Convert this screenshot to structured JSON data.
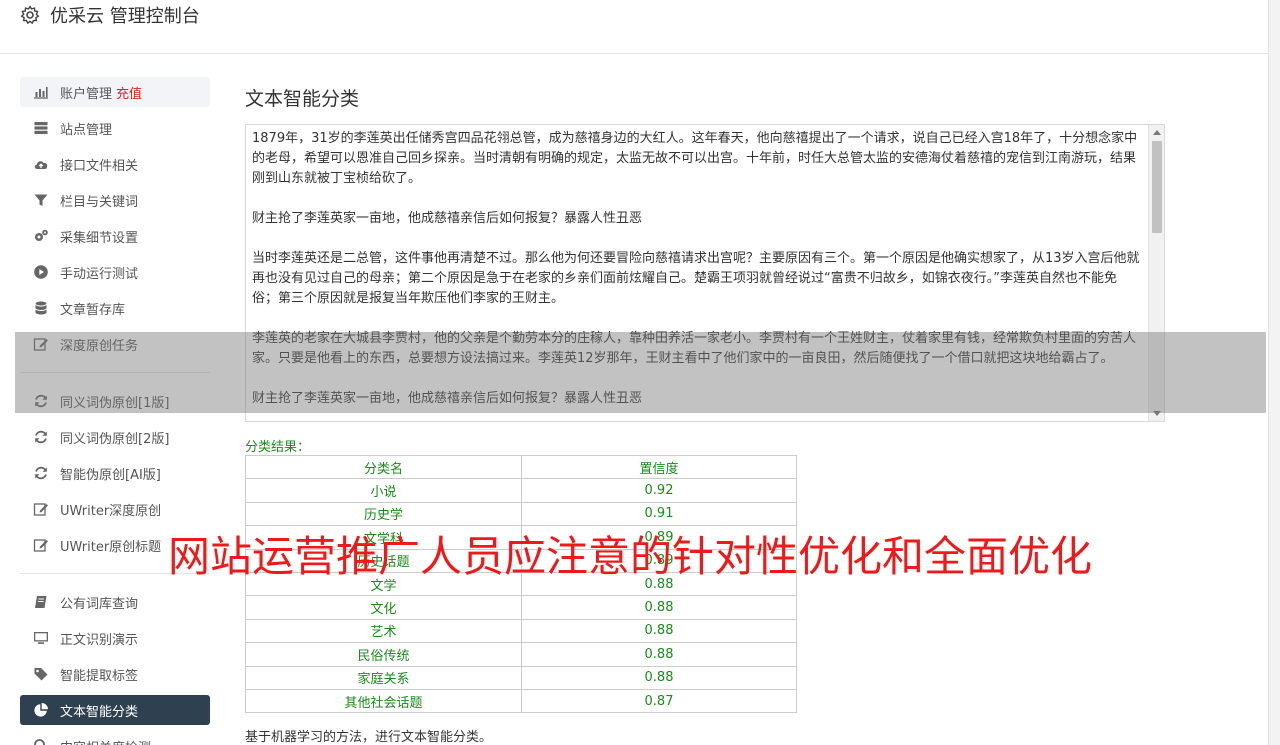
{
  "app": {
    "title": "优采云 管理控制台",
    "icon": "gear-icon"
  },
  "sidebar": {
    "items": [
      {
        "id": "account",
        "label": "账户管理",
        "badge": "充值",
        "icon": "bar-chart-icon"
      },
      {
        "id": "sites",
        "label": "站点管理",
        "icon": "server-icon"
      },
      {
        "id": "upload",
        "label": "接口文件相关",
        "icon": "cloud-upload-icon"
      },
      {
        "id": "columns",
        "label": "栏目与关键词",
        "icon": "filter-icon"
      },
      {
        "id": "collect",
        "label": "采集细节设置",
        "icon": "gears-icon"
      },
      {
        "id": "manual",
        "label": "手动运行测试",
        "icon": "play-circle-icon"
      },
      {
        "id": "articles",
        "label": "文章暂存库",
        "icon": "database-icon"
      },
      {
        "id": "deep",
        "label": "深度原创任务",
        "icon": "edit-icon"
      },
      {
        "id": "syn1",
        "label": "同义词伪原创[1版]",
        "icon": "refresh-icon"
      },
      {
        "id": "syn2",
        "label": "同义词伪原创[2版]",
        "icon": "refresh-icon"
      },
      {
        "id": "ai",
        "label": "智能伪原创[AI版]",
        "icon": "refresh-icon"
      },
      {
        "id": "uwriter",
        "label": "UWriter深度原创",
        "icon": "edit-icon"
      },
      {
        "id": "uwtitle",
        "label": "UWriter原创标题",
        "icon": "edit-icon"
      },
      {
        "id": "lexicon",
        "label": "公有词库查询",
        "icon": "book-icon"
      },
      {
        "id": "ocr",
        "label": "正文识别演示",
        "icon": "monitor-icon"
      },
      {
        "id": "tags",
        "label": "智能提取标签",
        "icon": "tag-icon"
      },
      {
        "id": "classify",
        "label": "文本智能分类",
        "icon": "pie-chart-icon"
      },
      {
        "id": "related",
        "label": "内容相关度检测",
        "icon": "search-icon"
      }
    ],
    "active": "文本智能分类"
  },
  "main": {
    "title": "文本智能分类",
    "text_paragraphs": [
      "1879年，31岁的李莲英出任储秀宫四品花翎总管，成为慈禧身边的大红人。这年春天，他向慈禧提出了一个请求，说自己已经入宫18年了，十分想念家中的老母，希望可以恩准自己回乡探亲。当时清朝有明确的规定，太监无故不可以出宫。十年前，时任大总管太监的安德海仗着慈禧的宠信到江南游玩，结果刚到山东就被丁宝桢给砍了。",
      "财主抢了李莲英家一亩地，他成慈禧亲信后如何报复？暴露人性丑恶",
      "当时李莲英还是二总管，这件事他再清楚不过。那么他为何还要冒险向慈禧请求出宫呢？主要原因有三个。第一个原因是他确实想家了，从13岁入宫后他就再也没有见过自己的母亲；第二个原因是急于在老家的乡亲们面前炫耀自己。楚霸王项羽就曾经说过“富贵不归故乡，如锦衣夜行。”李莲英自然也不能免俗；第三个原因就是报复当年欺压他们李家的王财主。",
      "李莲英的老家在大城县李贾村，他的父亲是个勤劳本分的庄稼人，靠种田养活一家老小。李贾村有一个王姓财主，仗着家里有钱，经常欺负村里面的穷苦人家。只要是他看上的东西，总要想方设法搞过来。李莲英12岁那年，王财主看中了他们家中的一亩良田，然后随便找了一个借口就把这块地给霸占了。",
      "财主抢了李莲英家一亩地，他成慈禧亲信后如何报复？暴露人性丑恶"
    ],
    "result_label": "分类结果：",
    "table": {
      "headers": [
        "分类名",
        "置信度"
      ],
      "rows": [
        [
          "小说",
          "0.92"
        ],
        [
          "历史学",
          "0.91"
        ],
        [
          "文学科",
          "0.89"
        ],
        [
          "历史话题",
          "0.89"
        ],
        [
          "文学",
          "0.88"
        ],
        [
          "文化",
          "0.88"
        ],
        [
          "艺术",
          "0.88"
        ],
        [
          "民俗传统",
          "0.88"
        ],
        [
          "家庭关系",
          "0.88"
        ],
        [
          "其他社会话题",
          "0.87"
        ]
      ]
    },
    "footer_note": "基于机器学习的方法，进行文本智能分类。"
  },
  "overlay": {
    "caption": "网站运营推广人员应注意的针对性优化和全面优化",
    "caption_color": "#ee1a1a"
  },
  "colors": {
    "active_nav_bg": "#2f4050",
    "result_green": "#1a8a1a",
    "badge_red": "#e02020"
  }
}
